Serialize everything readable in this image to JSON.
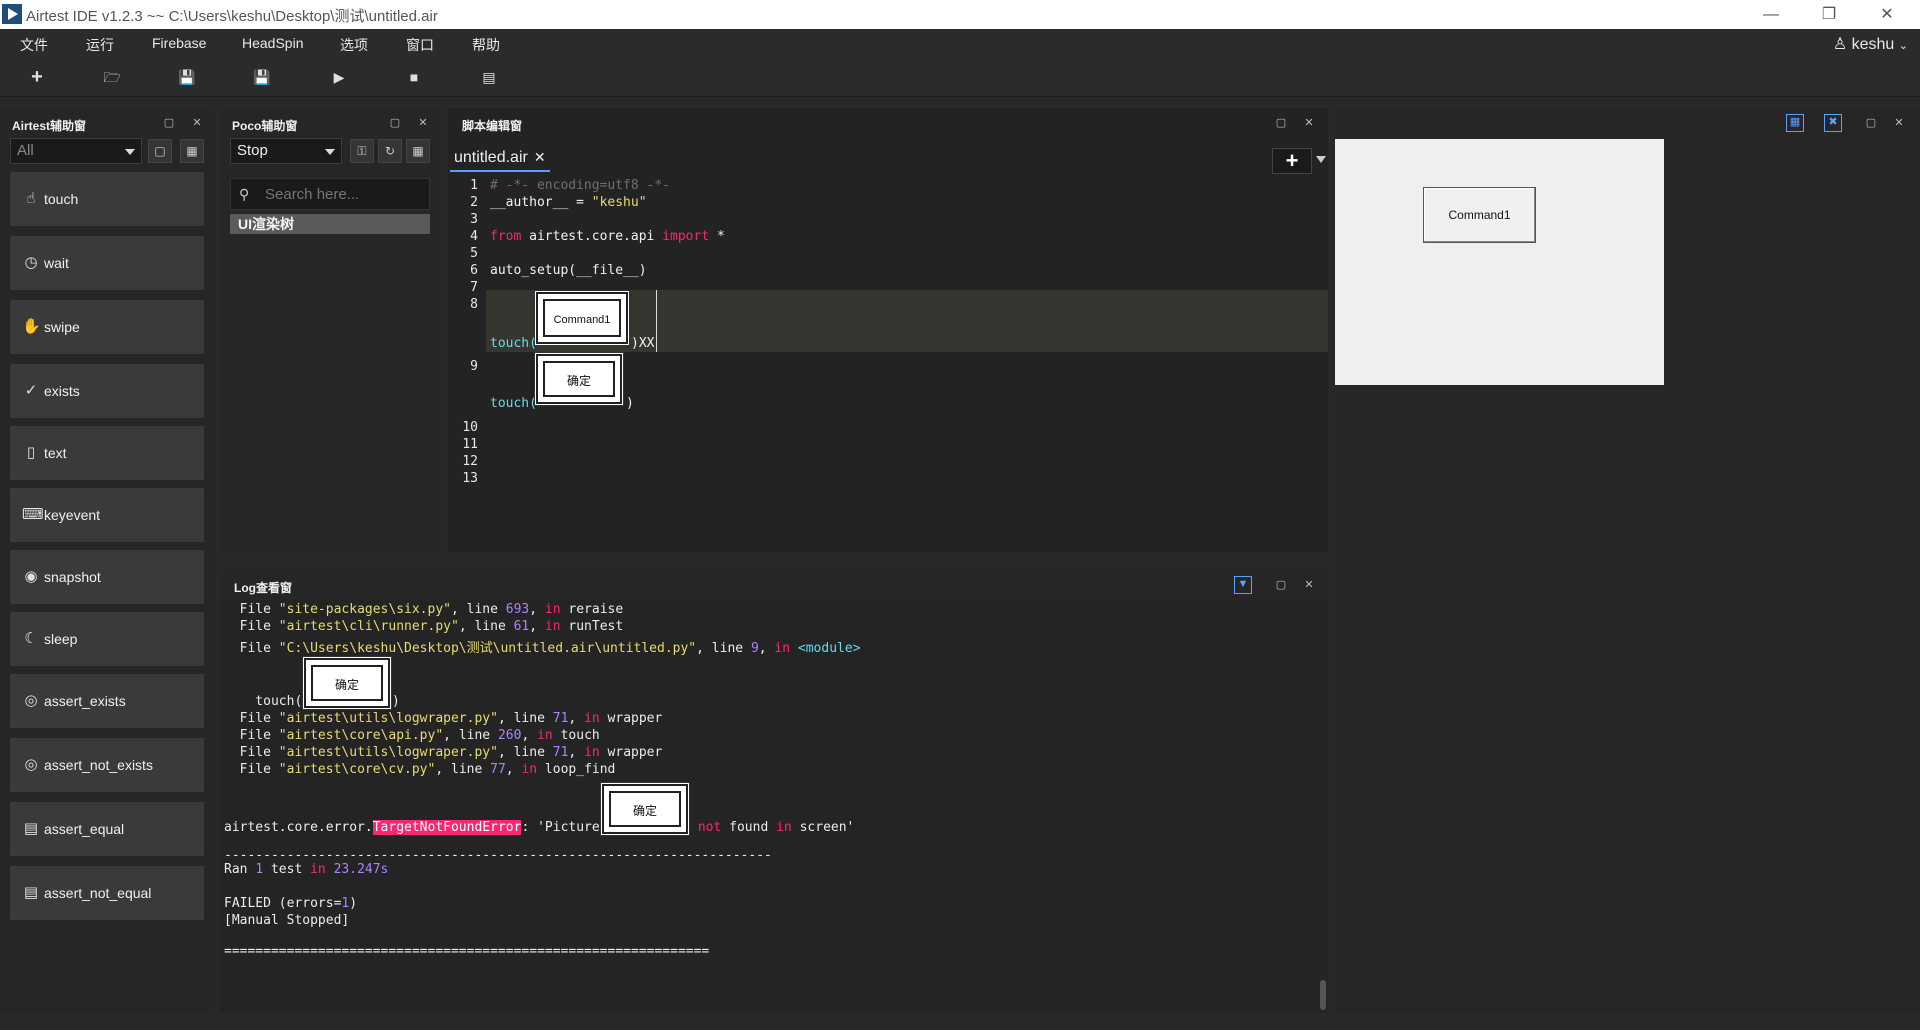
{
  "window": {
    "title": "Airtest IDE v1.2.3 ~~ C:\\Users\\keshu\\Desktop\\测试\\untitled.air",
    "minimize": "—",
    "restore": "❐",
    "close": "✕"
  },
  "menu": {
    "items": [
      "文件",
      "运行",
      "Firebase",
      "HeadSpin",
      "选项",
      "窗口",
      "帮助"
    ],
    "user": "keshu"
  },
  "toolbar": {
    "icons": [
      "new-file-icon",
      "open-folder-icon",
      "save-icon",
      "save-as-icon",
      "run-icon",
      "stop-icon",
      "log-icon"
    ]
  },
  "airtest_panel": {
    "title": "Airtest辅助窗",
    "filter_value": "All",
    "buttons": [
      {
        "label": "touch",
        "icon": "hand-icon"
      },
      {
        "label": "wait",
        "icon": "clock-icon"
      },
      {
        "label": "swipe",
        "icon": "swipe-icon"
      },
      {
        "label": "exists",
        "icon": "check-circle-icon"
      },
      {
        "label": "text",
        "icon": "text-icon"
      },
      {
        "label": "keyevent",
        "icon": "keyboard-icon"
      },
      {
        "label": "snapshot",
        "icon": "camera-icon"
      },
      {
        "label": "sleep",
        "icon": "moon-icon"
      },
      {
        "label": "assert_exists",
        "icon": "target-icon"
      },
      {
        "label": "assert_not_exists",
        "icon": "target-icon"
      },
      {
        "label": "assert_equal",
        "icon": "database-icon"
      },
      {
        "label": "assert_not_equal",
        "icon": "database-icon"
      }
    ]
  },
  "poco_panel": {
    "title": "Poco辅助窗",
    "mode_value": "Stop",
    "search_placeholder": "Search here...",
    "tree_root": "UI渲染树"
  },
  "editor_panel": {
    "title": "脚本编辑窗",
    "tab_label": "untitled.air",
    "tab_close": "✕",
    "lines": {
      "l1": "# -*- encoding=utf8 -*-",
      "l2_a": "__author__ = ",
      "l2_b": "\"keshu\"",
      "l4_from": "from",
      "l4_mod": " airtest.core.api ",
      "l4_import": "import",
      "l4_star": " *",
      "l6": "auto_setup(__file__)",
      "l8_call": "touch(",
      "l8_close": ")XX",
      "l9_call": "touch(",
      "l9_close": ")"
    },
    "line_numbers": [
      "1",
      "2",
      "3",
      "4",
      "5",
      "6",
      "7",
      "8",
      "9",
      "10",
      "11",
      "12",
      "13"
    ],
    "img_command1": "Command1",
    "img_confirm": "确定"
  },
  "log_panel": {
    "title": "Log查看窗",
    "lines": {
      "f1_a": "  File ",
      "f1_b": "\"site-packages\\six.py\"",
      "f1_c": ", line ",
      "f1_d": "693",
      "f1_e": ", ",
      "f1_f": "in",
      "f1_g": " reraise",
      "f2_a": "  File ",
      "f2_b": "\"airtest\\cli\\runner.py\"",
      "f2_c": ", line ",
      "f2_d": "61",
      "f2_e": ", ",
      "f2_f": "in",
      "f2_g": " runTest",
      "f3_a": "  File ",
      "f3_b": "\"C:\\Users\\keshu\\Desktop\\测试\\untitled.air\\untitled.py\"",
      "f3_c": ", line ",
      "f3_d": "9",
      "f3_e": ", ",
      "f3_f": "in",
      "f3_g": " <module>",
      "touch_call": "    touch(",
      "touch_close": ")",
      "f4_a": "  File ",
      "f4_b": "\"airtest\\utils\\logwraper.py\"",
      "f4_c": ", line ",
      "f4_d": "71",
      "f4_e": ", ",
      "f4_f": "in",
      "f4_g": " wrapper",
      "f5_a": "  File ",
      "f5_b": "\"airtest\\core\\api.py\"",
      "f5_c": ", line ",
      "f5_d": "260",
      "f5_e": ", ",
      "f5_f": "in",
      "f5_g": " touch",
      "f6_a": "  File ",
      "f6_b": "\"airtest\\utils\\logwraper.py\"",
      "f6_c": ", line ",
      "f6_d": "71",
      "f6_e": ", ",
      "f6_f": "in",
      "f6_g": " wrapper",
      "f7_a": "  File ",
      "f7_b": "\"airtest\\core\\cv.py\"",
      "f7_c": ", line ",
      "f7_d": "77",
      "f7_e": ", ",
      "f7_f": "in",
      "f7_g": " loop_find",
      "err_a": "airtest.core.error.",
      "err_b": "TargetNotFoundError",
      "err_c": ": 'Picture ",
      "err_d": " not",
      "err_e": " found ",
      "err_f": "in",
      "err_g": " screen'",
      "dashes": "----------------------------------------------------------------------",
      "ran_a": "Ran ",
      "ran_b": "1",
      "ran_c": " test ",
      "ran_d": "in",
      "ran_e": " 23.247s",
      "failed_a": "FAILED (errors=",
      "failed_b": "1",
      "failed_c": ")",
      "stopped": "[Manual Stopped]",
      "equals": "=============================================================="
    },
    "img_confirm": "确定"
  },
  "device_panel": {
    "button_label": "Command1"
  },
  "colors": {
    "accent": "#5aa0ff",
    "error_highlight": "#f92672",
    "string": "#e6db74",
    "keyword": "#f92672",
    "number": "#ae81ff"
  }
}
